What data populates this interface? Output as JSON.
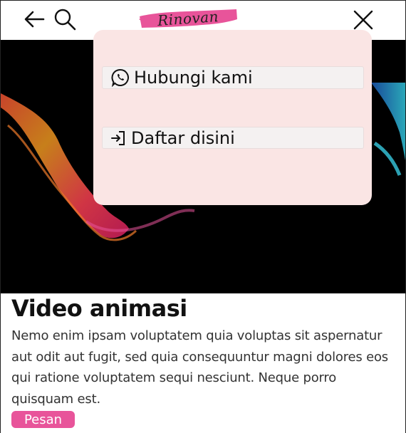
{
  "header": {
    "logo_text": "Rinovan",
    "back_icon": "arrow-left-icon",
    "search_icon": "search-icon",
    "close_icon": "close-icon",
    "logo_color": "#e8549a"
  },
  "menu": {
    "background": "#fae5e4",
    "items": [
      {
        "label": "Hubungi kami",
        "icon": "whatsapp-icon"
      },
      {
        "label": "Daftar disini",
        "icon": "login-icon"
      }
    ]
  },
  "article": {
    "title": "Video animasi",
    "body": "Nemo enim ipsam voluptatem quia voluptas sit aspernatur aut odit aut fugit, sed quia consequuntur magni dolores eos qui ratione voluptatem sequi nesciunt. Neque porro quisquam est.",
    "button_label": "Pesan",
    "button_color": "#e8549a"
  }
}
